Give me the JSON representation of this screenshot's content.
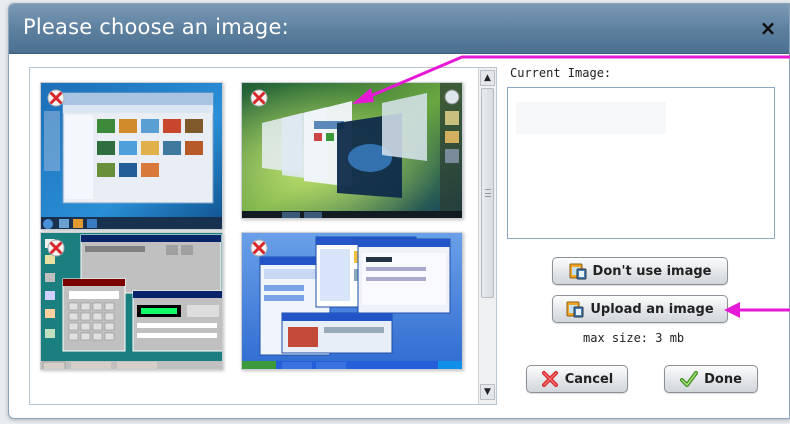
{
  "dialog": {
    "title": "Please choose an image:",
    "close_glyph": "×"
  },
  "gallery": {
    "thumbnails": [
      {
        "name": "windows-7-desktop",
        "delete_icon": "red-x-delete-icon"
      },
      {
        "name": "windows-vista-flip3d-desktop",
        "delete_icon": "red-x-delete-icon"
      },
      {
        "name": "windows-98-desktop",
        "delete_icon": "red-x-delete-icon"
      },
      {
        "name": "windows-xp-desktop",
        "delete_icon": "red-x-delete-icon"
      }
    ],
    "scroll_up_glyph": "▲",
    "scroll_down_glyph": "▼"
  },
  "panel": {
    "current_label": "Current Image:",
    "dont_use_label": "Don't use image",
    "upload_label": "Upload an image",
    "max_size_text": "max size: 3 mb",
    "cancel_label": "Cancel",
    "done_label": "Done"
  },
  "colors": {
    "titlebar": "#5c7f9e",
    "annotation_arrow": "#e619d6",
    "cancel_icon": "#d9262c",
    "done_icon": "#5aa832"
  }
}
